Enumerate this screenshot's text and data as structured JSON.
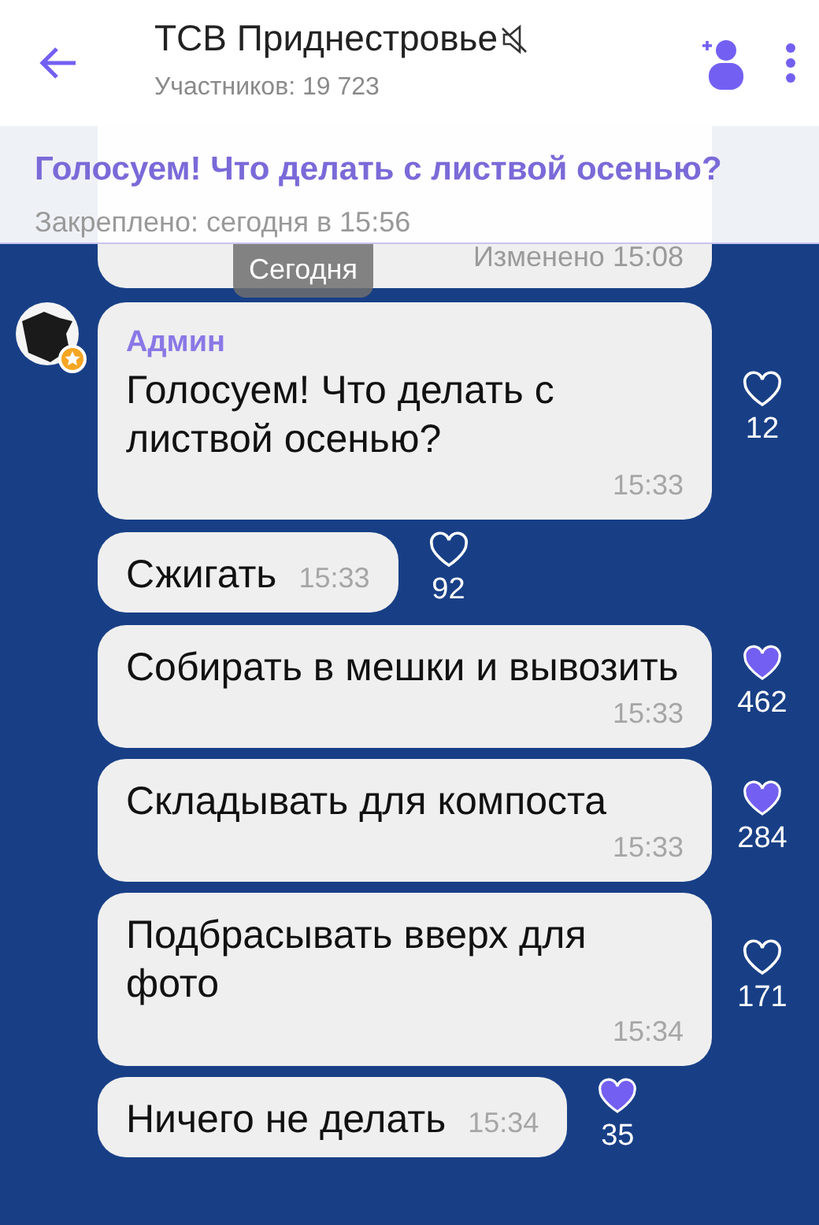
{
  "header": {
    "title": "ТСВ Приднестровье",
    "muted": true,
    "subtitle": "Участников: 19 723"
  },
  "pinned": {
    "text": "Голосуем! Что делать с листвой осенью?",
    "meta": "Закреплено: сегодня в 15:56"
  },
  "previous_message": {
    "meta": "Изменено 15:08"
  },
  "date_pill": "Сегодня",
  "messages": [
    {
      "sender": "Админ",
      "text": "Голосуем! Что делать с листвой осенью?",
      "time": "15:33",
      "likes": "12",
      "liked": false
    },
    {
      "text": "Сжигать",
      "time": "15:33",
      "likes": "92",
      "liked": false
    },
    {
      "text": "Собирать в мешки и вывозить",
      "time": "15:33",
      "likes": "462",
      "liked": true
    },
    {
      "text": "Складывать для компоста",
      "time": "15:33",
      "likes": "284",
      "liked": true
    },
    {
      "text": "Подбрасывать вверх для фото",
      "time": "15:34",
      "likes": "171",
      "liked": false
    },
    {
      "text": "Ничего не делать",
      "time": "15:34",
      "likes": "35",
      "liked": true
    }
  ]
}
